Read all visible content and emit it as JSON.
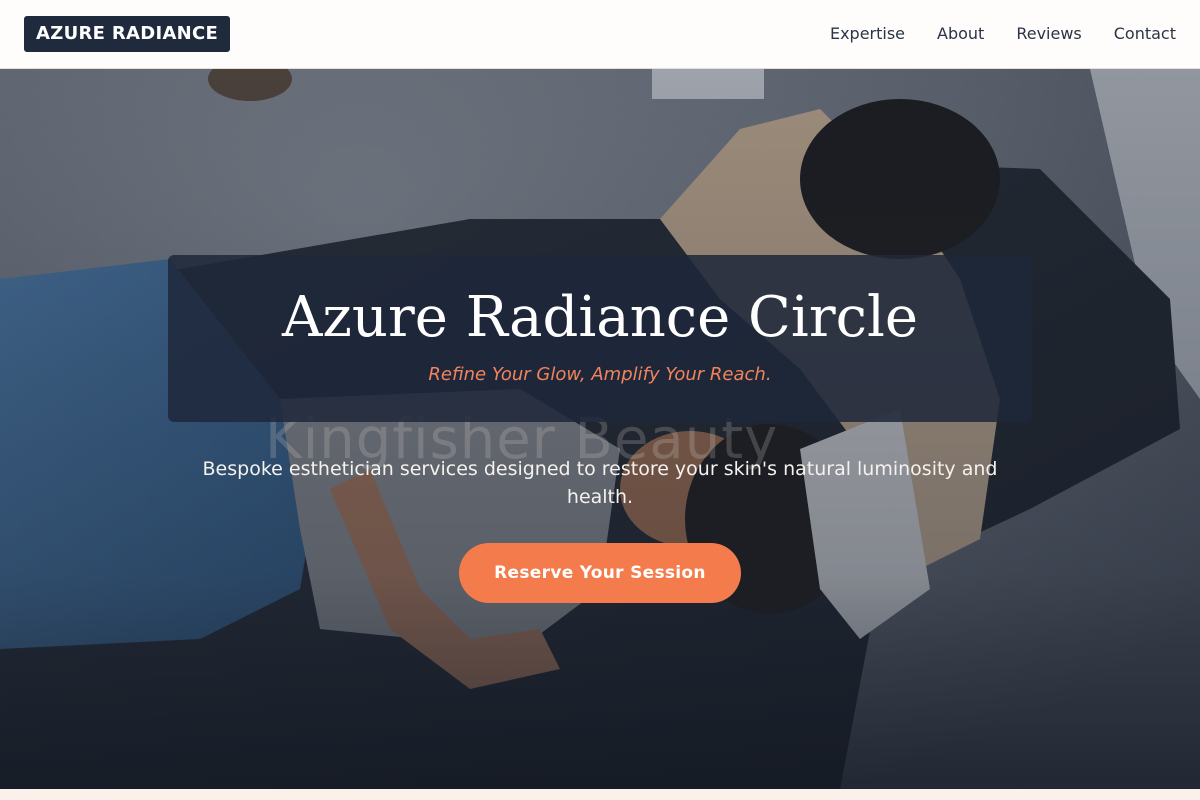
{
  "header": {
    "logo": "AZURE RADIANCE",
    "nav": [
      {
        "label": "Expertise"
      },
      {
        "label": "About"
      },
      {
        "label": "Reviews"
      },
      {
        "label": "Contact"
      }
    ]
  },
  "hero": {
    "title": "Azure Radiance Circle",
    "tagline": "Refine Your Glow, Amplify Your Reach.",
    "background_watermark": "Kingfisher Beauty",
    "description": "Bespoke esthetician services designed to restore your skin's natural luminosity and health.",
    "cta_label": "Reserve Your Session",
    "background_image": "photo of a woman reclining on a leather treatment chair while an esthetician works on her face"
  },
  "colors": {
    "brand_dark": "#1f2a3d",
    "accent": "#f47c4c",
    "tagline": "#f0845c",
    "header_bg": "#fffdfb"
  }
}
